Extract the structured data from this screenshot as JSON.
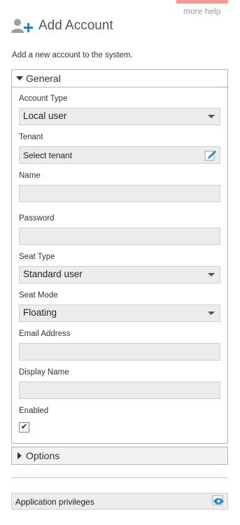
{
  "header": {
    "help_link": "more help",
    "title": "Add Account",
    "title_icon": "add-user-icon",
    "description": "Add a new account to the system."
  },
  "general": {
    "section_label": "General",
    "expanded": true,
    "fields": {
      "account_type": {
        "label": "Account Type",
        "value": "Local user"
      },
      "tenant": {
        "label": "Tenant",
        "value": "Select tenant",
        "icon": "edit-icon"
      },
      "name": {
        "label": "Name",
        "value": ""
      },
      "password": {
        "label": "Password",
        "value": ""
      },
      "seat_type": {
        "label": "Seat Type",
        "value": "Standard user"
      },
      "seat_mode": {
        "label": "Seat Mode",
        "value": "Floating"
      },
      "email": {
        "label": "Email Address",
        "value": ""
      },
      "display_name": {
        "label": "Display Name",
        "value": ""
      },
      "enabled": {
        "label": "Enabled",
        "checked": true,
        "mark": "✔"
      }
    }
  },
  "options": {
    "section_label": "Options",
    "expanded": false
  },
  "application_privileges": {
    "label": "Application privileges",
    "icon": "eye-icon"
  },
  "colors": {
    "accent": "#1e88c8",
    "help_tab": "#f29a9a",
    "field_bg": "#ececec"
  }
}
